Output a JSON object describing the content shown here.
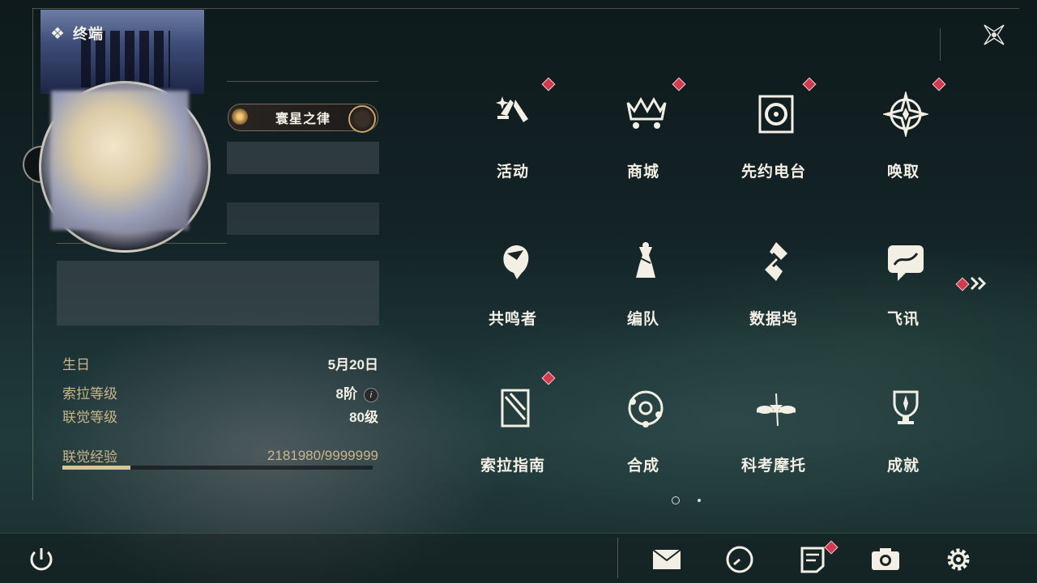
{
  "header": {
    "title": "终端",
    "close_icon": "close-star-icon"
  },
  "profile": {
    "badge_title": "寰星之律",
    "info": [
      {
        "label": "生日",
        "value": "5月20日"
      },
      {
        "label": "索拉等级",
        "value": "8阶"
      },
      {
        "label": "联觉等级",
        "value": "80级"
      }
    ],
    "exp": {
      "label": "联觉经验",
      "value": "2181980/9999999",
      "progress": 0.22
    }
  },
  "menu": {
    "items": [
      {
        "label": "活动",
        "icon": "sparkle-icon",
        "badge": true
      },
      {
        "label": "商城",
        "icon": "crown-cart-icon",
        "badge": true
      },
      {
        "label": "先约电台",
        "icon": "radio-disc-icon",
        "badge": true
      },
      {
        "label": "唤取",
        "icon": "compass-star-icon",
        "badge": true
      },
      {
        "label": "共鸣者",
        "icon": "character-head-icon",
        "badge": false
      },
      {
        "label": "编队",
        "icon": "chess-team-icon",
        "badge": false
      },
      {
        "label": "数据坞",
        "icon": "data-dock-icon",
        "badge": false
      },
      {
        "label": "飞讯",
        "icon": "message-bubble-icon",
        "badge": false
      },
      {
        "label": "索拉指南",
        "icon": "guide-book-icon",
        "badge": true
      },
      {
        "label": "合成",
        "icon": "synthesis-icon",
        "badge": false
      },
      {
        "label": "科考摩托",
        "icon": "motorbike-icon",
        "badge": false
      },
      {
        "label": "成就",
        "icon": "trophy-icon",
        "badge": false
      }
    ],
    "next_page_icon": "double-chevron-right-icon",
    "pages": 2,
    "current_page": 1
  },
  "bottom_bar": {
    "items": [
      {
        "name": "power-icon"
      },
      {
        "name": "mail-icon"
      },
      {
        "name": "clock-icon"
      },
      {
        "name": "notes-icon"
      },
      {
        "name": "camera-icon"
      },
      {
        "name": "settings-gear-icon"
      }
    ]
  },
  "colors": {
    "accent_gold": "#c9b58a",
    "badge_red": "#d23b4e",
    "text": "#f3efe4"
  }
}
